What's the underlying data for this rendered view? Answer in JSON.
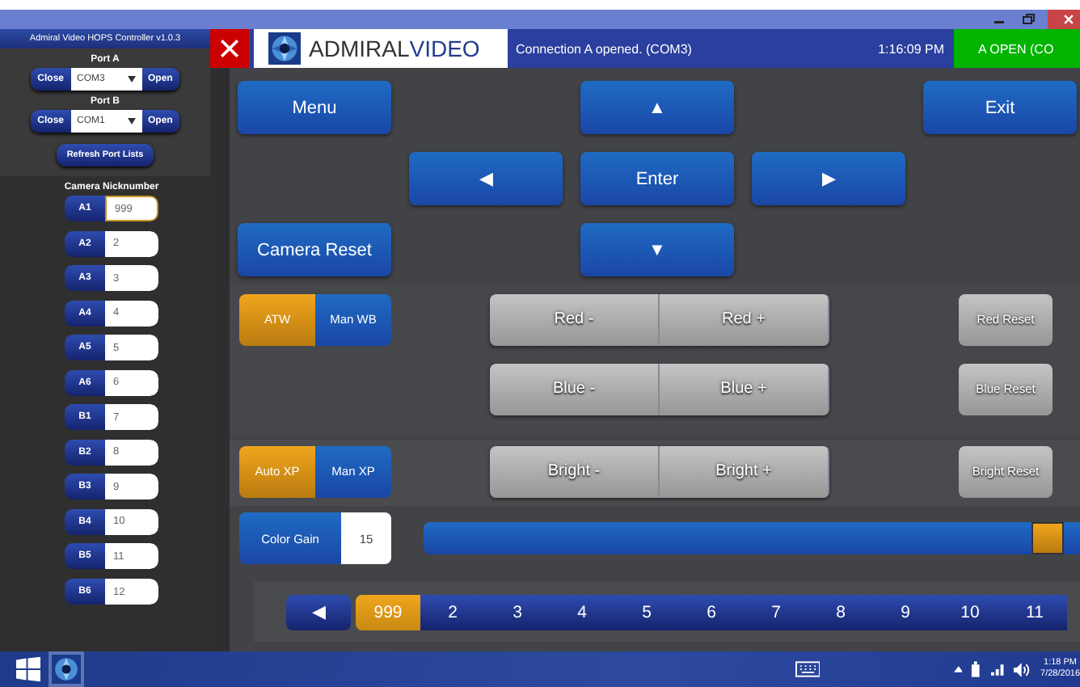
{
  "sidebar": {
    "title": "Admiral Video HOPS Controller v1.0.3",
    "ports": [
      {
        "label": "Port A",
        "close": "Close",
        "value": "COM3",
        "open": "Open"
      },
      {
        "label": "Port B",
        "close": "Close",
        "value": "COM1",
        "open": "Open"
      }
    ],
    "refresh": "Refresh Port Lists",
    "cameras_title": "Camera Nicknumber",
    "cameras": [
      {
        "id": "A1",
        "value": "999",
        "focused": true
      },
      {
        "id": "A2",
        "value": "2",
        "focused": false
      },
      {
        "id": "A3",
        "value": "3",
        "focused": false
      },
      {
        "id": "A4",
        "value": "4",
        "focused": false
      },
      {
        "id": "A5",
        "value": "5",
        "focused": false
      },
      {
        "id": "A6",
        "value": "6",
        "focused": false
      },
      {
        "id": "B1",
        "value": "7",
        "focused": false
      },
      {
        "id": "B2",
        "value": "8",
        "focused": false
      },
      {
        "id": "B3",
        "value": "9",
        "focused": false
      },
      {
        "id": "B4",
        "value": "10",
        "focused": false
      },
      {
        "id": "B5",
        "value": "11",
        "focused": false
      },
      {
        "id": "B6",
        "value": "12",
        "focused": false
      }
    ]
  },
  "header": {
    "brand_first": "ADMIRAL",
    "brand_second": "VIDEO",
    "message": "Connection A opened. (COM3)",
    "time": "1:16:09 PM",
    "status": "A OPEN (CO"
  },
  "nav": {
    "menu": "Menu",
    "up": "▲",
    "exit": "Exit",
    "left": "◀",
    "enter": "Enter",
    "right": "▶",
    "camera_reset": "Camera Reset",
    "down": "▼"
  },
  "wb_modes": [
    {
      "label": "ATW",
      "selected": true
    },
    {
      "label": "Man WB",
      "selected": false
    }
  ],
  "xp_modes": [
    {
      "label": "Auto XP",
      "selected": true
    },
    {
      "label": "Man XP",
      "selected": false
    }
  ],
  "adjust_rows": [
    {
      "minus": "Red -",
      "plus": "Red +",
      "reset": "Red Reset"
    },
    {
      "minus": "Blue -",
      "plus": "Blue +",
      "reset": "Blue Reset"
    },
    {
      "minus": "Bright -",
      "plus": "Bright +",
      "reset": "Bright Reset"
    }
  ],
  "color_gain": {
    "label": "Color Gain",
    "value": "15",
    "level": 0.95
  },
  "camera_strip": {
    "prev": "◀",
    "items": [
      {
        "label": "999",
        "selected": true
      },
      {
        "label": "2",
        "selected": false
      },
      {
        "label": "3",
        "selected": false
      },
      {
        "label": "4",
        "selected": false
      },
      {
        "label": "5",
        "selected": false
      },
      {
        "label": "6",
        "selected": false
      },
      {
        "label": "7",
        "selected": false
      },
      {
        "label": "8",
        "selected": false
      },
      {
        "label": "9",
        "selected": false
      },
      {
        "label": "10",
        "selected": false
      },
      {
        "label": "11",
        "selected": false
      }
    ]
  },
  "taskbar": {
    "time": "1:18 PM",
    "date": "7/28/2016"
  }
}
